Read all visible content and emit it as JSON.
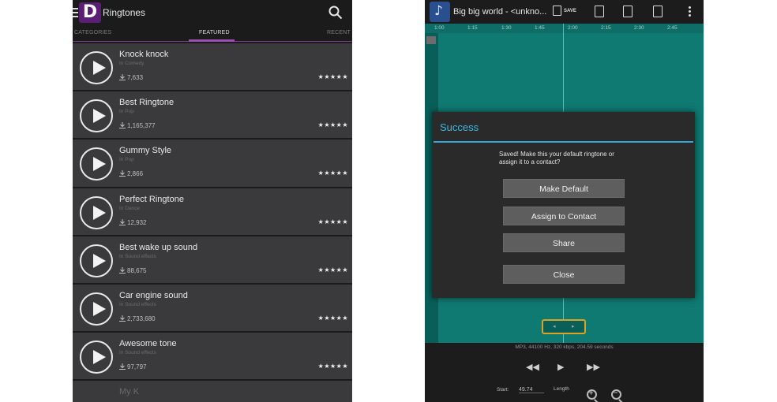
{
  "ringtones_app": {
    "title": "Ringtones",
    "logo_letter": "D",
    "tabs": [
      {
        "label": "CATEGORIES"
      },
      {
        "label": "FEATURED"
      },
      {
        "label": "RECENT"
      }
    ],
    "items": [
      {
        "name": "Knock knock",
        "category": "In Comedy",
        "downloads": "7,633",
        "rating": "★★★★★"
      },
      {
        "name": "Best Ringtone",
        "category": "In Pop",
        "downloads": "1,165,377",
        "rating": "★★★★★"
      },
      {
        "name": "Gummy Style",
        "category": "In Pop",
        "downloads": "2,866",
        "rating": "★★★★★"
      },
      {
        "name": "Perfect Ringtone",
        "category": "In Dance",
        "downloads": "12,932",
        "rating": "★★★★★"
      },
      {
        "name": "Best wake up sound",
        "category": "In Sound effects",
        "downloads": "88,675",
        "rating": "★★★★★"
      },
      {
        "name": "Car engine sound",
        "category": "In Sound effects",
        "downloads": "2,733,680",
        "rating": "★★★★★"
      },
      {
        "name": "Awesome tone",
        "category": "In Sound effects",
        "downloads": "97,797",
        "rating": "★★★★★"
      }
    ],
    "partial_item": "My K",
    "colors": {
      "accent": "#9b4fb5",
      "background": "#1b1b1b",
      "row": "#3a3a3d"
    }
  },
  "editor_app": {
    "song_title": "Big big world - <unkno...",
    "save_label": "SAVE",
    "timeline_ticks": [
      "1:00",
      "1:15",
      "1:30",
      "1:45",
      "2:00",
      "2:15",
      "2:30",
      "2:45"
    ],
    "file_info": "MP3, 44100 Hz, 320 kbps, 204.59 seconds",
    "start_label": "Start:",
    "start_value": "49.74",
    "length_label": "Length",
    "colors": {
      "waveform": "#0f7a72",
      "handle": "#d9a421"
    }
  },
  "dialog": {
    "title": "Success",
    "message": "Saved! Make this your default ringtone or assign it to a contact?",
    "buttons": {
      "make_default": "Make Default",
      "assign": "Assign to Contact",
      "share": "Share",
      "close": "Close"
    },
    "colors": {
      "title": "#3fb6e0"
    }
  }
}
